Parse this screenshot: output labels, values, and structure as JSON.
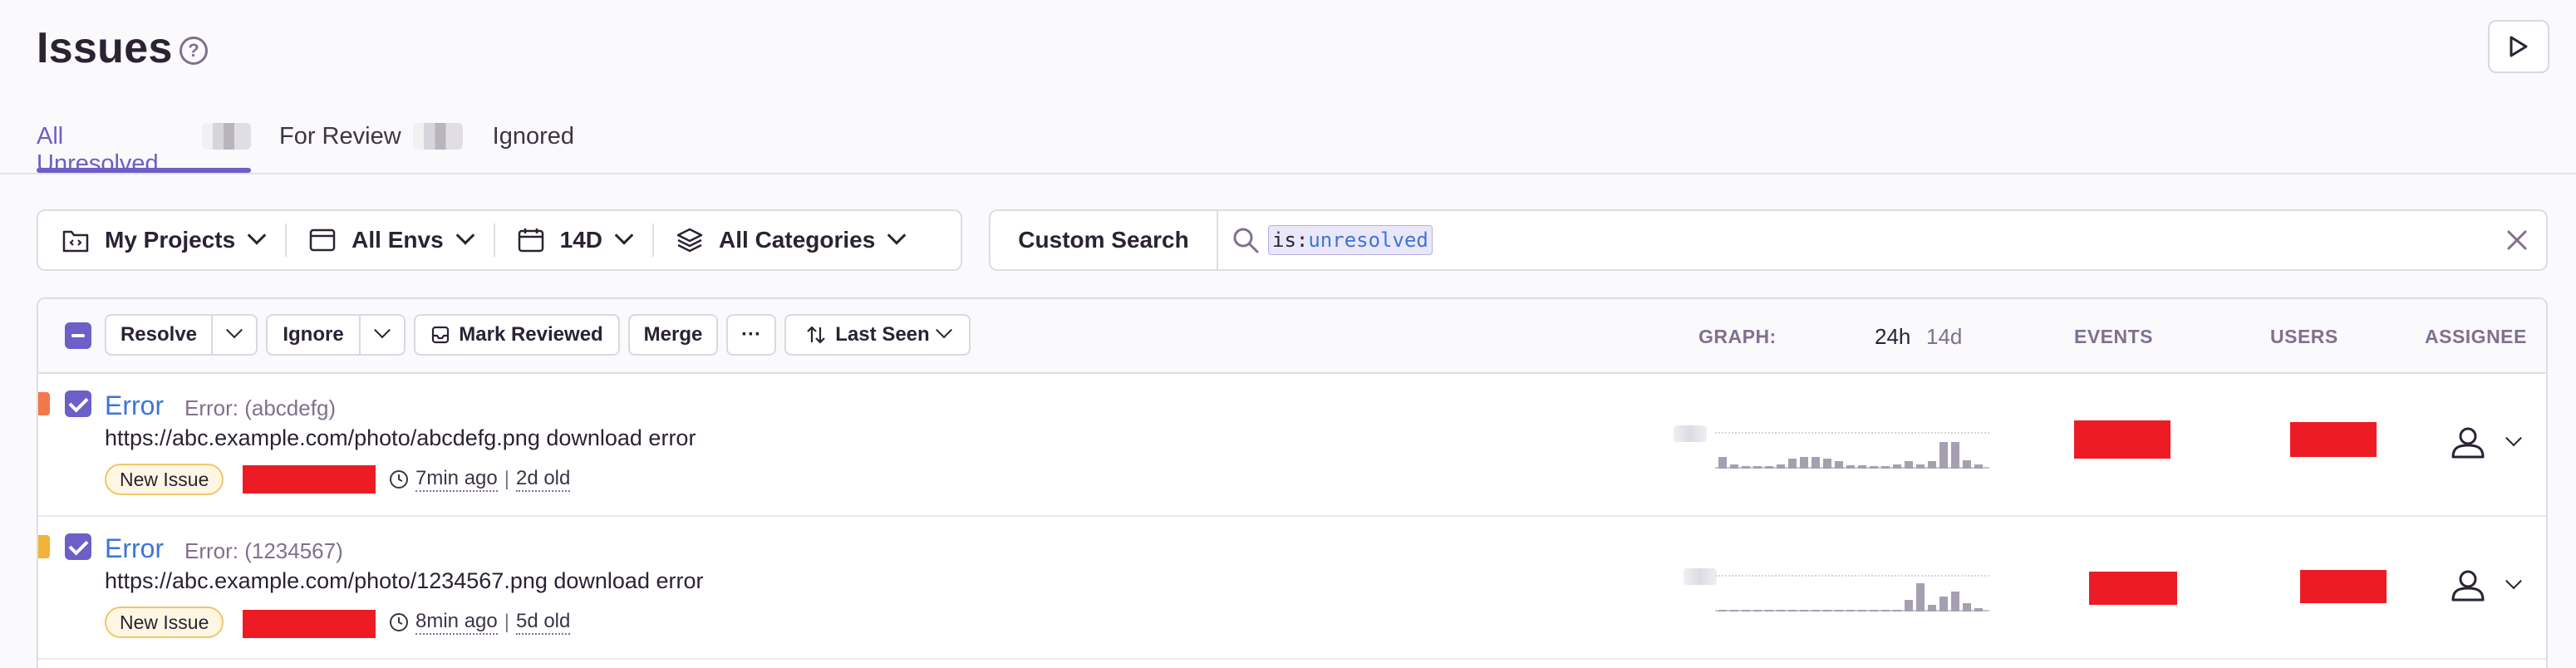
{
  "header": {
    "title": "Issues"
  },
  "tabs": [
    {
      "label": "All Unresolved",
      "active": true
    },
    {
      "label": "For Review"
    },
    {
      "label": "Ignored"
    }
  ],
  "filters": {
    "projects": "My Projects",
    "envs": "All Envs",
    "period": "14D",
    "categories": "All Categories"
  },
  "search": {
    "custom_label": "Custom Search",
    "token_key": "is:",
    "token_value": "unresolved"
  },
  "toolbar": {
    "resolve": "Resolve",
    "ignore": "Ignore",
    "mark_reviewed": "Mark Reviewed",
    "merge": "Merge",
    "more": "···",
    "sort": "Last Seen"
  },
  "columns": {
    "graph": "GRAPH:",
    "period_24h": "24h",
    "period_14d": "14d",
    "events": "EVENTS",
    "users": "USERS",
    "assignee": "ASSIGNEE"
  },
  "issues": [
    {
      "level_color": "#f2784b",
      "type": "Error",
      "subtitle": "Error: (abcdefg)",
      "message": "https://abc.example.com/photo/abcdefg.png download error",
      "badge": "New Issue",
      "last_seen": "7min ago",
      "age": "2d old",
      "spark": [
        0.35,
        0.12,
        0.08,
        0.08,
        0.08,
        0.12,
        0.3,
        0.35,
        0.35,
        0.3,
        0.22,
        0.1,
        0.1,
        0.08,
        0.08,
        0.12,
        0.22,
        0.12,
        0.22,
        0.8,
        0.8,
        0.25,
        0.12
      ]
    },
    {
      "level_color": "#f2b33a",
      "type": "Error",
      "subtitle": "Error: (1234567)",
      "message": "https://abc.example.com/photo/1234567.png download error",
      "badge": "New Issue",
      "last_seen": "8min ago",
      "age": "5d old",
      "spark": [
        0.04,
        0.04,
        0.04,
        0.04,
        0.04,
        0.04,
        0.04,
        0.04,
        0.04,
        0.04,
        0.04,
        0.04,
        0.04,
        0.04,
        0.04,
        0.04,
        0.35,
        0.85,
        0.2,
        0.45,
        0.6,
        0.25,
        0.1
      ]
    }
  ],
  "icons": {
    "help": "help-icon",
    "play": "play-icon",
    "projects": "project-icon",
    "envs": "window-icon",
    "calendar": "calendar-icon",
    "categories": "layers-icon",
    "search": "search-icon",
    "clear": "close-icon",
    "sort": "sort-icon",
    "clock": "clock-icon",
    "user": "user-icon"
  },
  "colors": {
    "accent": "#6c5fc7",
    "link": "#3d74db"
  }
}
